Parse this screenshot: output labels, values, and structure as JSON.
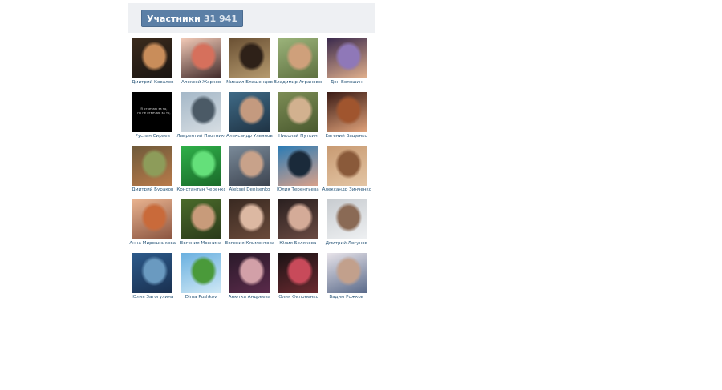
{
  "widget": {
    "title": "Участники",
    "count": "31 941",
    "colors": {
      "header_bg": "#eef0f3",
      "button_bg": "#5b7fa6",
      "name_link": "#2b587a"
    }
  },
  "members": [
    {
      "name": "Дмитрий Ковалев",
      "colors": [
        "#3a2a1c",
        "#c98d5a",
        "#1a1512"
      ]
    },
    {
      "name": "Алексей Жарков",
      "colors": [
        "#f1c9b6",
        "#d6705c",
        "#402a2a"
      ]
    },
    {
      "name": "Михаил Блашенцев",
      "colors": [
        "#6b5134",
        "#2e2118",
        "#b59a6e"
      ]
    },
    {
      "name": "Владимир Аграновский",
      "colors": [
        "#9bb37a",
        "#cfa07b",
        "#5e7040"
      ]
    },
    {
      "name": "Ден Волошин",
      "colors": [
        "#3b2a4d",
        "#8f78b8",
        "#e1b08c"
      ]
    },
    {
      "name": "Руслан Сираев",
      "colors": [
        "#000000",
        "#050505",
        "#111111"
      ],
      "text": "Я отвечаю за то,\nно не отвечаю за то,"
    },
    {
      "name": "Лаврентий Плотников",
      "colors": [
        "#a5b8c8",
        "#4b5a66",
        "#d6dde2"
      ]
    },
    {
      "name": "Александр Ульянов",
      "colors": [
        "#3f6a86",
        "#c49a7f",
        "#1f3344"
      ]
    },
    {
      "name": "Николай Путкин",
      "colors": [
        "#7c8c55",
        "#d2b18f",
        "#4a5a2f"
      ]
    },
    {
      "name": "Евгений Ващенко",
      "colors": [
        "#3a1a14",
        "#a0552e",
        "#e0a27a"
      ]
    },
    {
      "name": "Дмитрий Бураков",
      "colors": [
        "#6f5a3a",
        "#8d9c5a",
        "#b87a4a"
      ]
    },
    {
      "name": "Константин Черенков",
      "colors": [
        "#2fb049",
        "#64e07a",
        "#1a6a2a"
      ]
    },
    {
      "name": "Aleksej Denisenko",
      "colors": [
        "#7a8a99",
        "#c8a28a",
        "#3d4450"
      ]
    },
    {
      "name": "Юлия Терентьева",
      "colors": [
        "#2a7bb5",
        "#1a2a3a",
        "#d8a08a"
      ]
    },
    {
      "name": "Александр Зинченко",
      "colors": [
        "#c89a72",
        "#8a5a3a",
        "#e3c5a4"
      ]
    },
    {
      "name": "Анна Мирошникова",
      "colors": [
        "#e8b28f",
        "#c96a3a",
        "#8a5440"
      ]
    },
    {
      "name": "Евгения Мохнина",
      "colors": [
        "#4a6a2a",
        "#c89b7a",
        "#2a3a1a"
      ]
    },
    {
      "name": "Евгения Климентова",
      "colors": [
        "#3a2a22",
        "#dcb8a2",
        "#6a4a3a"
      ]
    },
    {
      "name": "Юлия Белякова",
      "colors": [
        "#2a2020",
        "#d4ab98",
        "#6a4a42"
      ]
    },
    {
      "name": "Дмитрий Логунов",
      "colors": [
        "#c8ccd0",
        "#8a6a55",
        "#eef0f2"
      ]
    },
    {
      "name": "Юлия Загогулина",
      "colors": [
        "#2c5a8a",
        "#6a9ac0",
        "#1a3050"
      ]
    },
    {
      "name": "Dima Pushkov",
      "colors": [
        "#6ab0e0",
        "#4a9a3a",
        "#cfe8f5"
      ]
    },
    {
      "name": "Анютка Андреева",
      "colors": [
        "#2a1a2a",
        "#d2a0a8",
        "#5a2a4a"
      ]
    },
    {
      "name": "Юлия Филоненко",
      "colors": [
        "#1a1214",
        "#c84a5a",
        "#6a2a30"
      ]
    },
    {
      "name": "Вадим Рожков",
      "colors": [
        "#e8e4ea",
        "#c2a08c",
        "#5a6a8a"
      ]
    }
  ]
}
